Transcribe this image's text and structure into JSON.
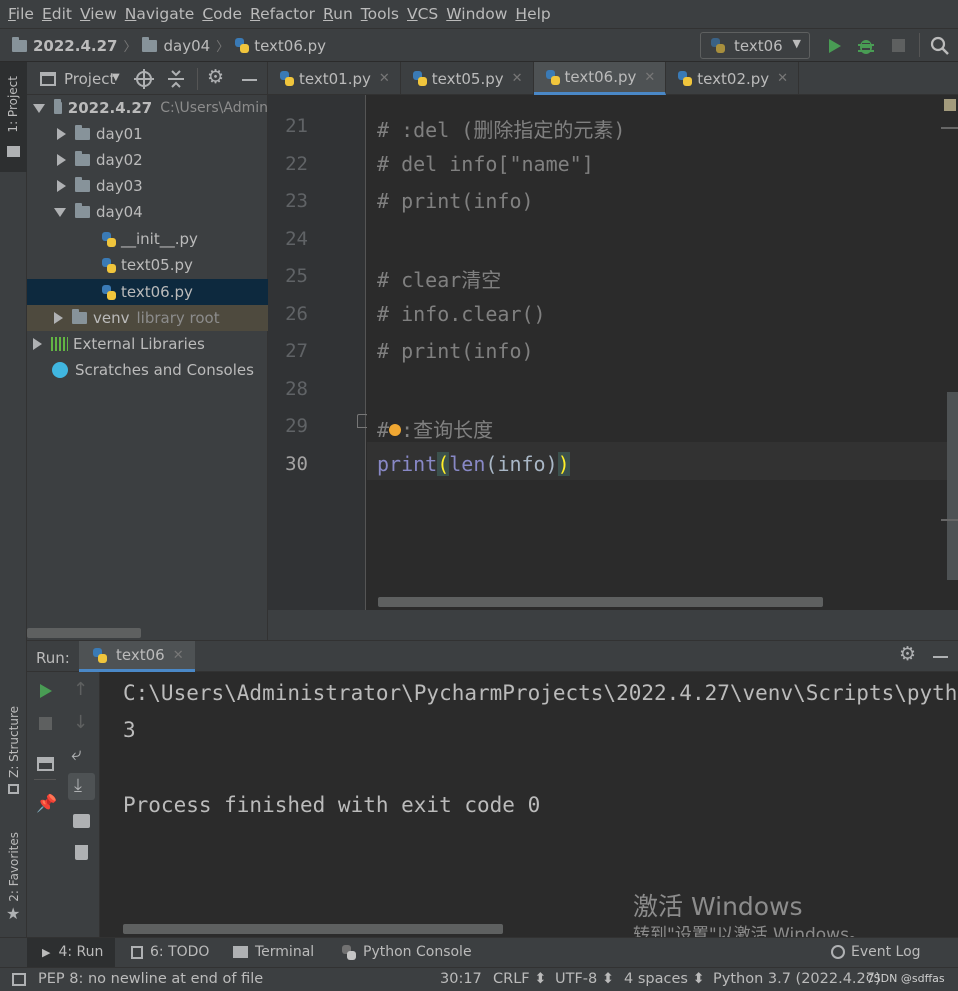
{
  "menu": [
    "File",
    "Edit",
    "View",
    "Navigate",
    "Code",
    "Refactor",
    "Run",
    "Tools",
    "VCS",
    "Window",
    "Help"
  ],
  "breadcrumb": {
    "project": "2022.4.27",
    "folder": "day04",
    "file": "text06.py"
  },
  "run_config": "text06",
  "left_stripe": {
    "project": "1: Project",
    "structure": "Z: Structure",
    "favorites": "2: Favorites"
  },
  "project_panel": {
    "title": "Project",
    "root": {
      "name": "2022.4.27",
      "path": "C:\\Users\\Admin"
    },
    "folders": [
      "day01",
      "day02",
      "day03",
      "day04"
    ],
    "day04_files": [
      "__init__.py",
      "text05.py",
      "text06.py"
    ],
    "venv": {
      "name": "venv",
      "hint": "library root"
    },
    "external": "External Libraries",
    "scratches": "Scratches and Consoles"
  },
  "tabs": [
    "text01.py",
    "text05.py",
    "text06.py",
    "text02.py"
  ],
  "active_tab": "text06.py",
  "code_lines": [
    {
      "n": "21",
      "text": "# :del (删除指定的元素)"
    },
    {
      "n": "22",
      "text": "# del info[\"name\"]"
    },
    {
      "n": "23",
      "text": "# print(info)"
    },
    {
      "n": "24",
      "text": ""
    },
    {
      "n": "25",
      "text": "# clear清空"
    },
    {
      "n": "26",
      "text": "# info.clear()"
    },
    {
      "n": "27",
      "text": "# print(info)"
    },
    {
      "n": "28",
      "text": ""
    },
    {
      "n": "29",
      "text": "# :查询长度"
    },
    {
      "n": "30",
      "text": "print(len(info))"
    }
  ],
  "run_panel": {
    "label": "Run:",
    "tab": "text06"
  },
  "console_lines": [
    "C:\\Users\\Administrator\\PycharmProjects\\2022.4.27\\venv\\Scripts\\python.exe",
    "3",
    "",
    "Process finished with exit code 0"
  ],
  "bottom_tabs": {
    "run": "4: Run",
    "todo": "6: TODO",
    "terminal": "Terminal",
    "python_console": "Python Console",
    "event_log": "Event Log"
  },
  "watermark": {
    "line1": "激活 Windows",
    "line2": "转到\"设置\"以激活 Windows。"
  },
  "status": {
    "message": "PEP 8: no newline at end of file",
    "position": "30:17",
    "line_sep": "CRLF ⬍",
    "encoding": "UTF-8 ⬍",
    "indent": "4 spaces ⬍",
    "interpreter": "Python 3.7 (2022.4.27)",
    "credit": "CSDN @sdffas"
  },
  "colors": {
    "keyword_builtin": "#8888c6",
    "comment": "#808080",
    "accent": "#4a88c7",
    "run_green": "#499c54"
  }
}
